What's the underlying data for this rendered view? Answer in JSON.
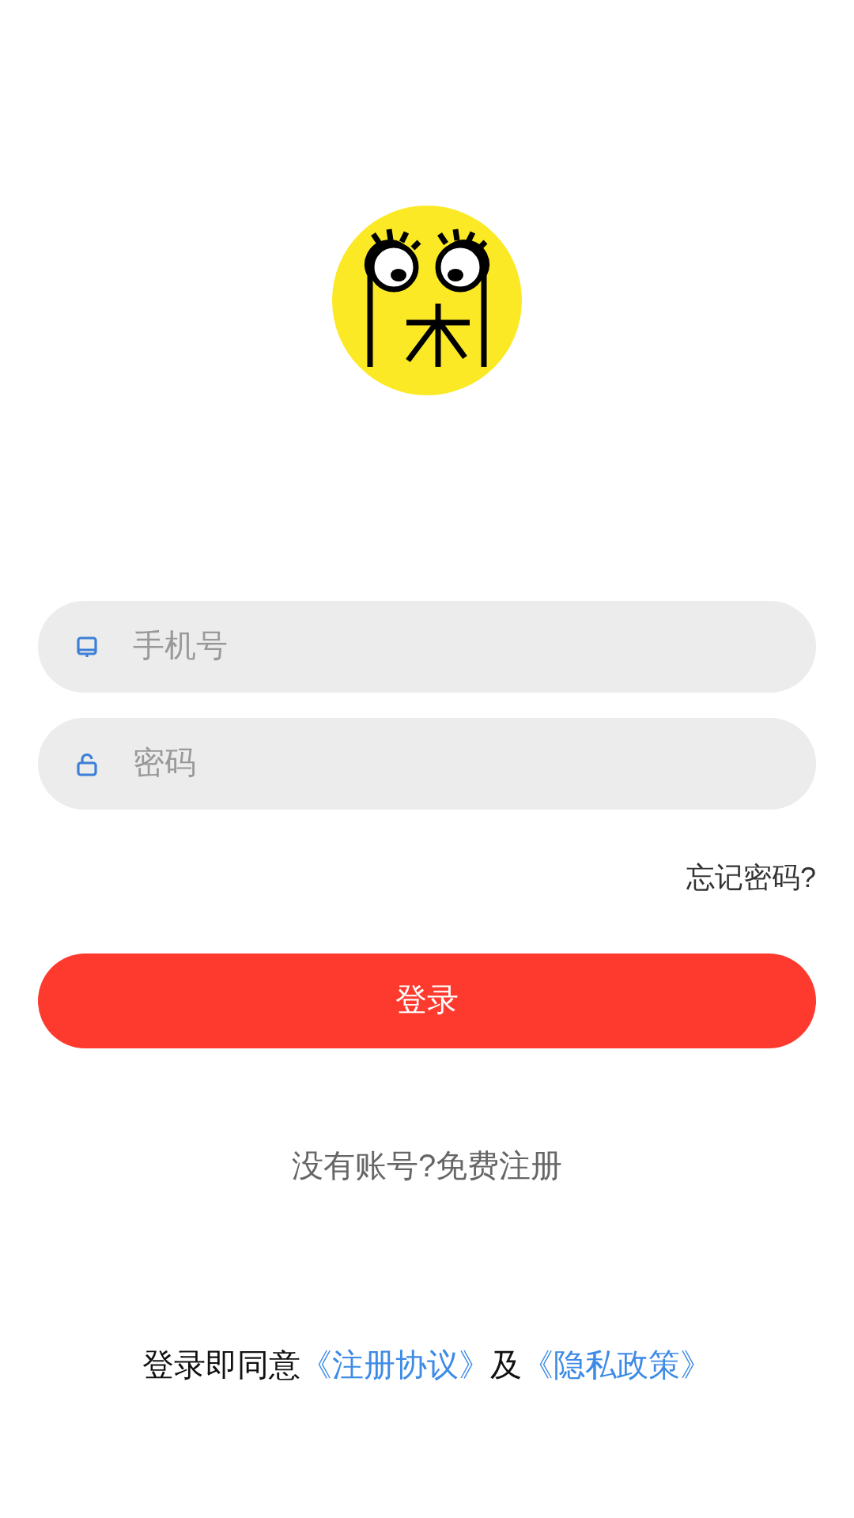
{
  "phone_field": {
    "placeholder": "手机号"
  },
  "password_field": {
    "placeholder": "密码"
  },
  "forgot_password": "忘记密码?",
  "login_button": "登录",
  "register_link": "没有账号?免费注册",
  "agreement": [
    {
      "kind": "plain",
      "text": "登录即同意"
    },
    {
      "kind": "link",
      "text": "《注册协议》"
    },
    {
      "kind": "plain",
      "text": "及"
    },
    {
      "kind": "link",
      "text": "《隐私政策》"
    }
  ]
}
